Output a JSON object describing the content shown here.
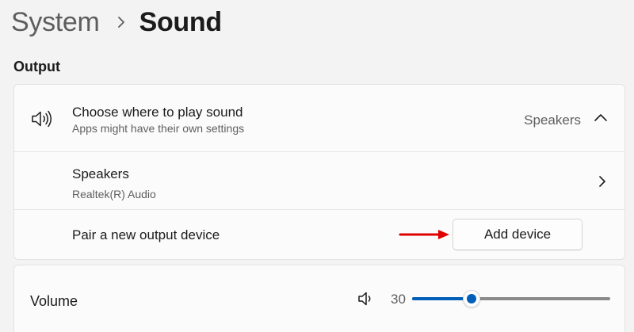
{
  "breadcrumb": {
    "parent": "System",
    "current": "Sound"
  },
  "output": {
    "section_title": "Output",
    "choose": {
      "icon": "speaker-icon",
      "title": "Choose where to play sound",
      "subtitle": "Apps might have their own settings",
      "selected": "Speakers",
      "expand_icon": "chevron-up-icon"
    },
    "device": {
      "name": "Speakers",
      "driver": "Realtek(R) Audio",
      "nav_icon": "chevron-right-icon"
    },
    "pair": {
      "label": "Pair a new output device",
      "button_label": "Add device",
      "annotation": "red-arrow-icon"
    }
  },
  "volume": {
    "label": "Volume",
    "icon": "volume-icon",
    "value": "30",
    "level": 0.3
  },
  "colors": {
    "accent": "#005fb8",
    "annotation": "#e00000"
  }
}
